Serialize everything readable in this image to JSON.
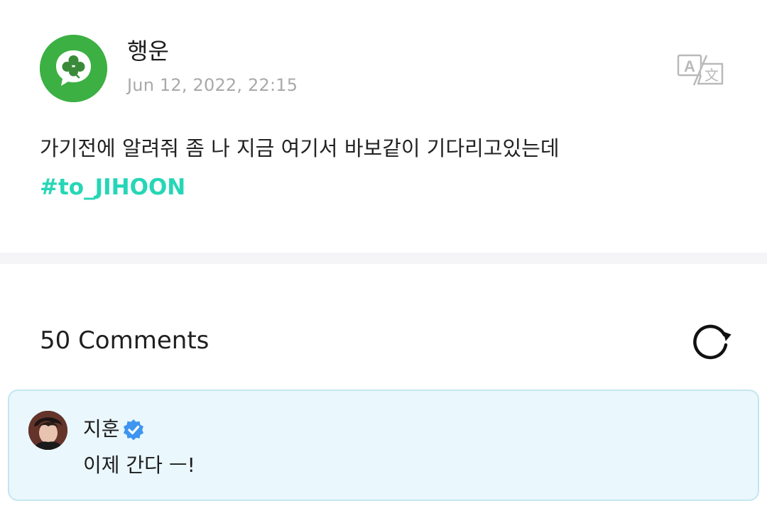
{
  "post": {
    "author_name": "행운",
    "date": "Jun 12, 2022, 22:15",
    "body": "가기전에 알려줘 좀 나 지금 여기서 바보같이 기다리고있는데",
    "hashtag": "#to_JIHOON",
    "avatar_icon": "clover-chat-bubble-icon",
    "translate_icon": "translate-icon"
  },
  "comments": {
    "count_label": "50 Comments",
    "refresh_icon": "refresh-icon",
    "items": [
      {
        "author": "지훈",
        "verified": true,
        "text": "이제 간다 ㅡ!"
      }
    ]
  },
  "colors": {
    "hashtag": "#26d6b6",
    "avatar_green": "#3cb043",
    "comment_bg": "#eaf7fd",
    "comment_border": "#c4e6ef",
    "verified_blue": "#3d95f0",
    "date_gray": "#a9a9a9"
  }
}
